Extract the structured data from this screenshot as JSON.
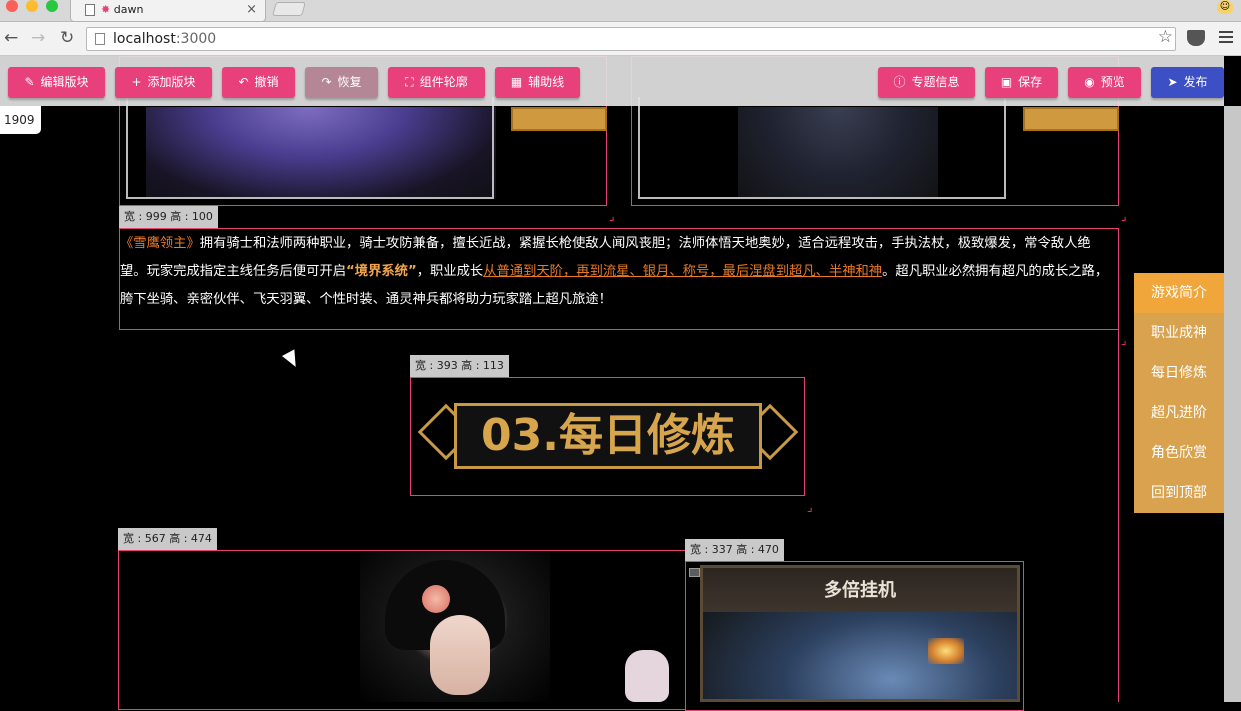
{
  "browser": {
    "tab_title": "dawn",
    "tab_close": "×",
    "url_host": "localhost",
    "url_port": ":3000",
    "back_icon": "←",
    "forward_icon": "→",
    "reload_icon": "↻",
    "star_icon": "☆"
  },
  "toolbar": {
    "left": [
      {
        "label": "编辑版块",
        "icon": "✎"
      },
      {
        "label": "添加版块",
        "icon": "+"
      },
      {
        "label": "撤销",
        "icon": "↶"
      },
      {
        "label": "恢复",
        "icon": "↷"
      },
      {
        "label": "组件轮廓",
        "icon": "⛶"
      },
      {
        "label": "辅助线",
        "icon": "▦"
      }
    ],
    "right": [
      {
        "label": "专题信息",
        "icon": "ⓘ"
      },
      {
        "label": "保存",
        "icon": "▣"
      },
      {
        "label": "预览",
        "icon": "◉"
      },
      {
        "label": "发布",
        "icon": "➤"
      }
    ]
  },
  "scroll_position": "1909",
  "blocks": {
    "text_block_size": "宽 : 999 高 : 100",
    "title_block_size": "宽 : 393 高 : 113",
    "char_block_size": "宽 : 567 高 : 474",
    "screenshot_block_size": "宽 : 337 高 : 470"
  },
  "intro": {
    "game_name": "《雪鹰领主》",
    "part1": "拥有骑士和法师两种职业，骑士攻防兼备，擅长近战，紧握长枪使敌人闻风丧胆；法师体悟天地奥妙，适合远程攻击，手执法杖，极致爆发，常令敌人绝望。玩家完成指定主线任务后便可开启",
    "system_name": "“境界系统”",
    "part2": "，职业成长",
    "link_text": "从普通到天阶，再到流星、银月、称号，最后涅盘到超凡、半神和神",
    "part3": "。超凡职业必然拥有超凡的成长之路，胯下坐骑、亲密伙伴、飞天羽翼、个性时装、通灵神兵都将助力玩家踏上超凡旅途！"
  },
  "section_title": "03.每日修炼",
  "game_screenshot_title": "多倍挂机",
  "side_nav": {
    "items": [
      "游戏简介",
      "职业成神",
      "每日修炼",
      "超凡进阶",
      "角色欣赏",
      "回到顶部"
    ],
    "active_index": 0
  },
  "colors": {
    "accent": "#e8407b",
    "primary": "#3c4fc4",
    "nav_gold": "#d9a24e",
    "highlight_orange": "#e97a25"
  }
}
